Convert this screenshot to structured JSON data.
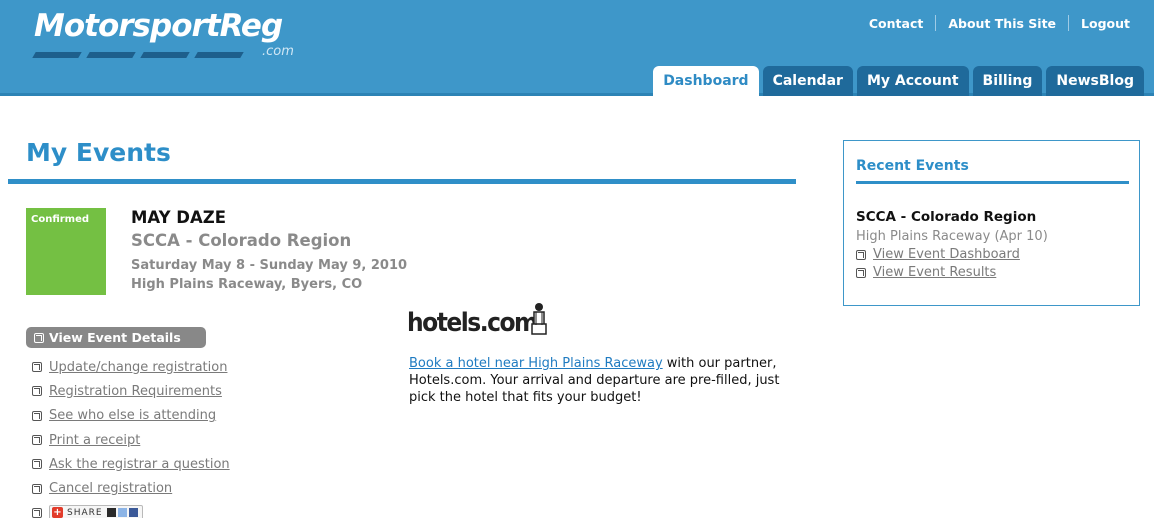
{
  "brand": {
    "logo_text": "MotorsportReg",
    "logo_com": ".com"
  },
  "top_links": {
    "contact": "Contact",
    "about": "About This Site",
    "logout": "Logout"
  },
  "tabs": [
    {
      "label": "Dashboard",
      "active": true
    },
    {
      "label": "Calendar",
      "active": false
    },
    {
      "label": "My Account",
      "active": false
    },
    {
      "label": "Billing",
      "active": false
    },
    {
      "label": "NewsBlog",
      "active": false
    }
  ],
  "page_title": "My Events",
  "event": {
    "status": "Confirmed",
    "name": "MAY DAZE",
    "organization": "SCCA - Colorado Region",
    "dates": "Saturday May 8 - Sunday May 9, 2010",
    "venue": "High Plains Raceway, Byers, CO",
    "details_button": "View Event Details",
    "actions": [
      "Update/change registration",
      "Registration Requirements",
      "See who else is attending",
      "Print a receipt",
      "Ask the registrar a question",
      "Cancel registration"
    ],
    "share_label": "SHARE"
  },
  "hotels": {
    "logo_text": "hotels.com",
    "link_text": "Book a hotel near High Plains Raceway",
    "body_text": " with our partner, Hotels.com. Your arrival and departure are pre-filled, just pick the hotel that fits your budget!"
  },
  "recent_events": {
    "title": "Recent Events",
    "organization": "SCCA - Colorado Region",
    "venue_date": "High Plains Raceway (Apr 10)",
    "links": [
      "View Event Dashboard",
      "View Event Results"
    ]
  },
  "colors": {
    "header_bg": "#3e97c9",
    "accent_blue": "#2d8ec8",
    "status_green": "#74c043"
  }
}
